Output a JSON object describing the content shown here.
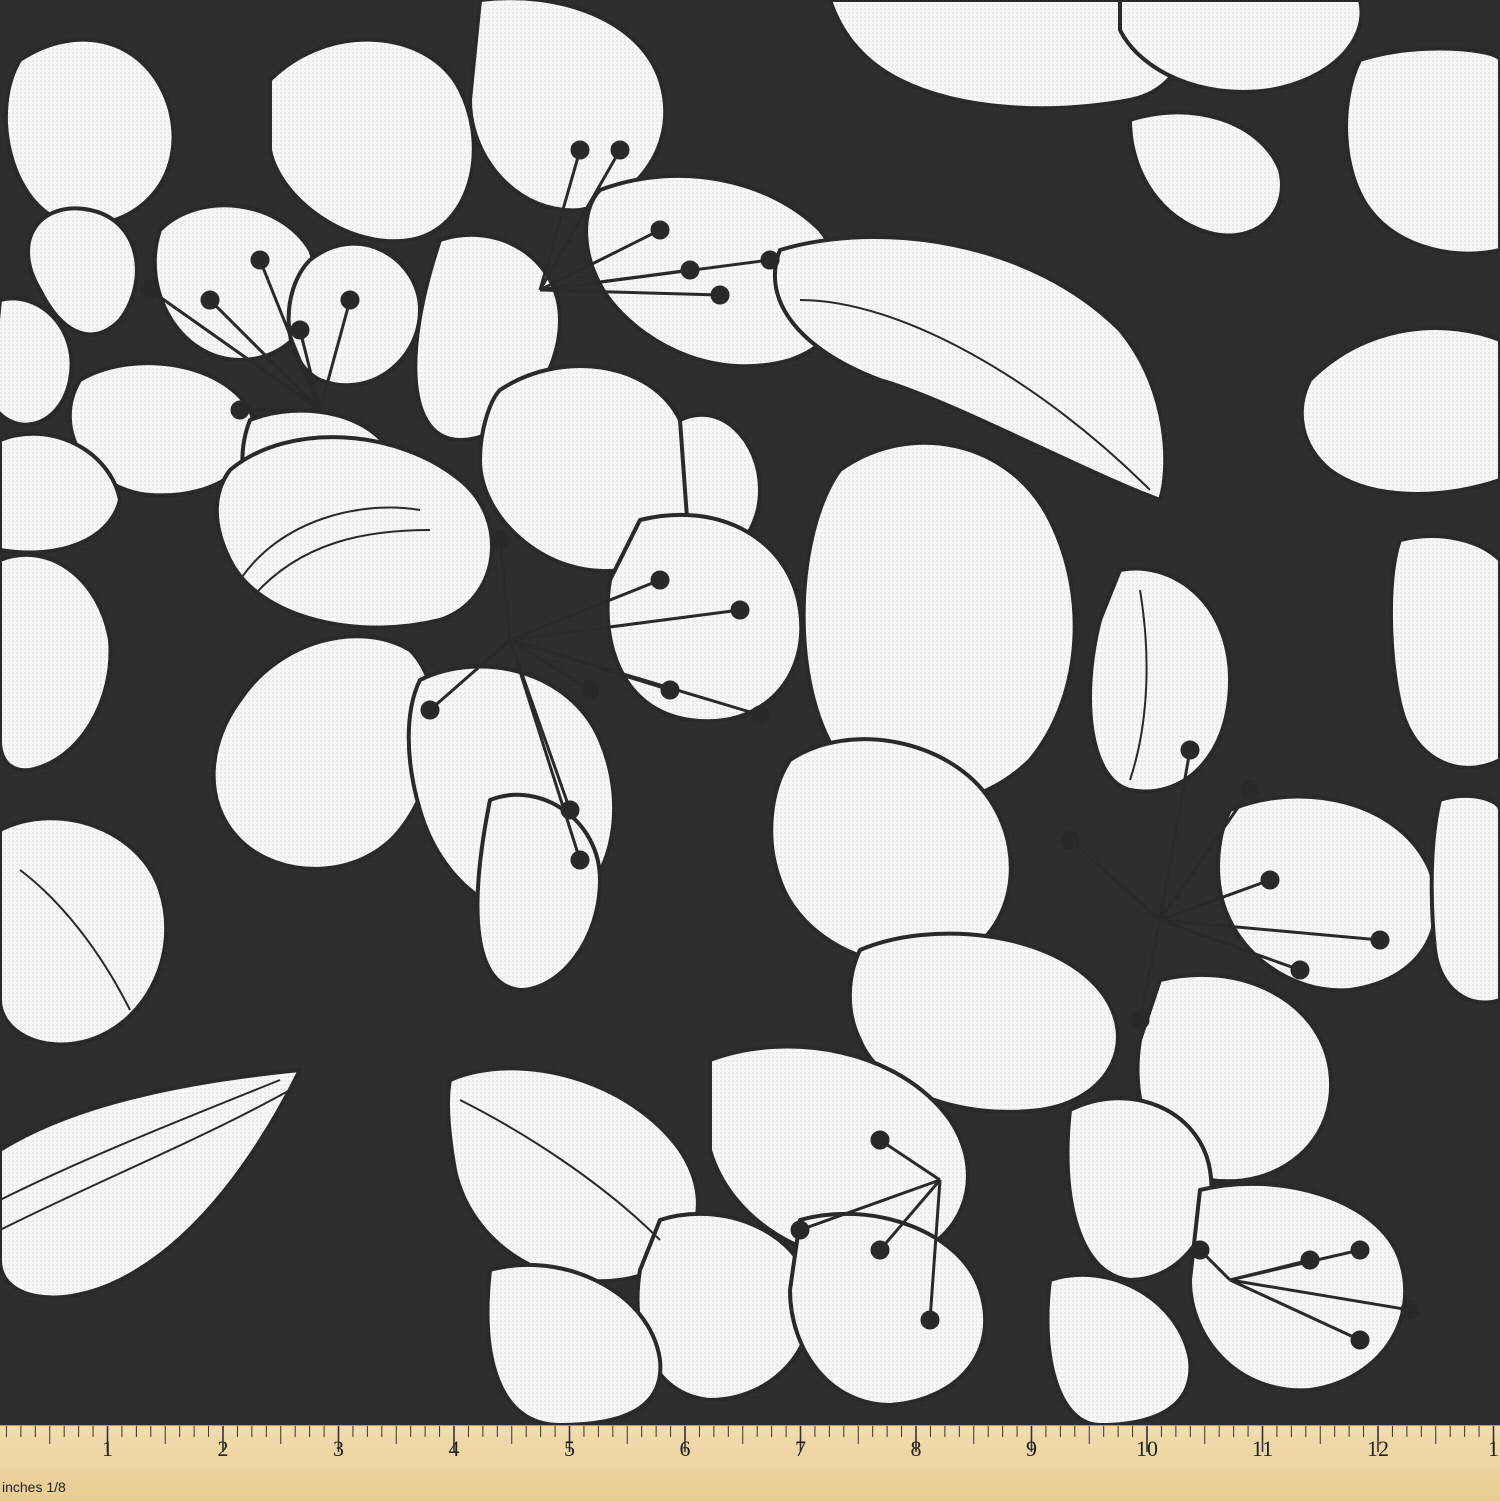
{
  "pattern": {
    "background_color": "#2e2e2e",
    "petal_color": "#f6f6f4",
    "outline_color": "#2a2a2a"
  },
  "ruler": {
    "unit_label": "inches",
    "fraction_label": "1/8",
    "numbers": [
      "1",
      "2",
      "3",
      "4",
      "5",
      "6",
      "7",
      "8",
      "9",
      "10",
      "11",
      "12",
      "1"
    ],
    "color": "#ecd29c"
  }
}
